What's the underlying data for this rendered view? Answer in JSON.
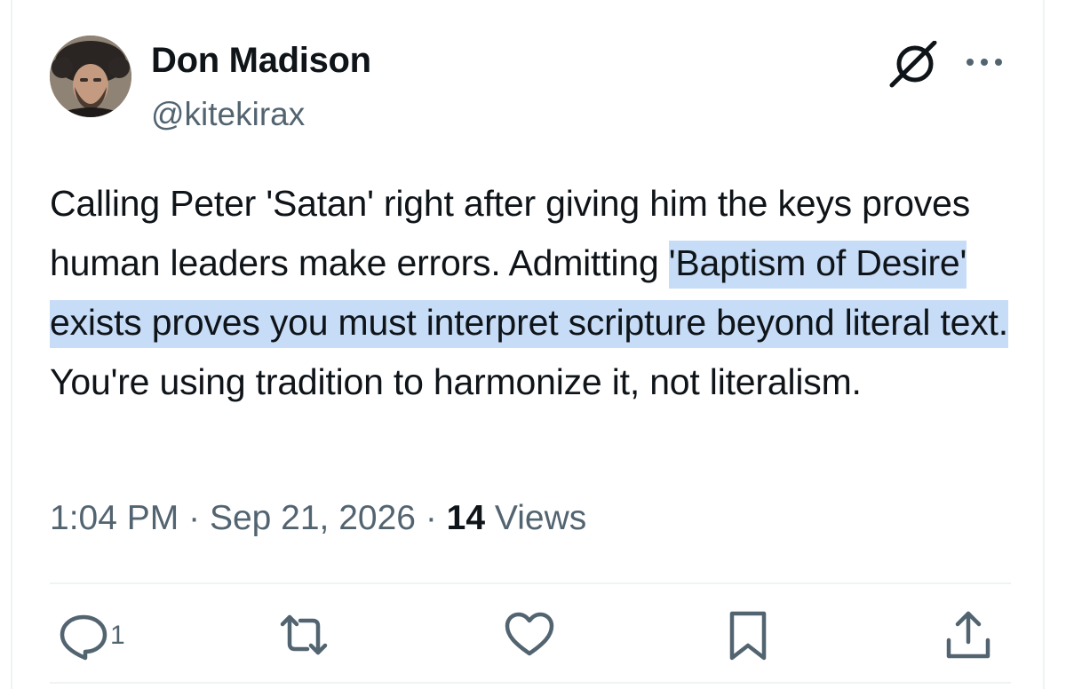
{
  "author": {
    "display_name": "Don Madison",
    "handle": "@kitekirax"
  },
  "header_icons": [
    "grok-icon",
    "more-icon"
  ],
  "tweet": {
    "text_before": "Calling Peter 'Satan' right after giving him the keys proves human leaders make errors. Admitting ",
    "text_highlighted": "'Baptism of Desire' exists proves you must interpret scripture beyond literal text.",
    "text_after": " You're using tradition to harmonize it, not literalism.",
    "highlight_color": "#c7dcf7"
  },
  "meta": {
    "time": "1:04 PM",
    "separator": "·",
    "date": "Sep 21, 2026",
    "views_count": "14",
    "views_label": "Views"
  },
  "actions": {
    "reply_count": "1",
    "icons": [
      "reply-icon",
      "retweet-icon",
      "like-icon",
      "bookmark-icon",
      "share-icon"
    ]
  },
  "colors": {
    "text_primary": "#0f1419",
    "text_secondary": "#536471",
    "divider": "#eff3f4"
  }
}
